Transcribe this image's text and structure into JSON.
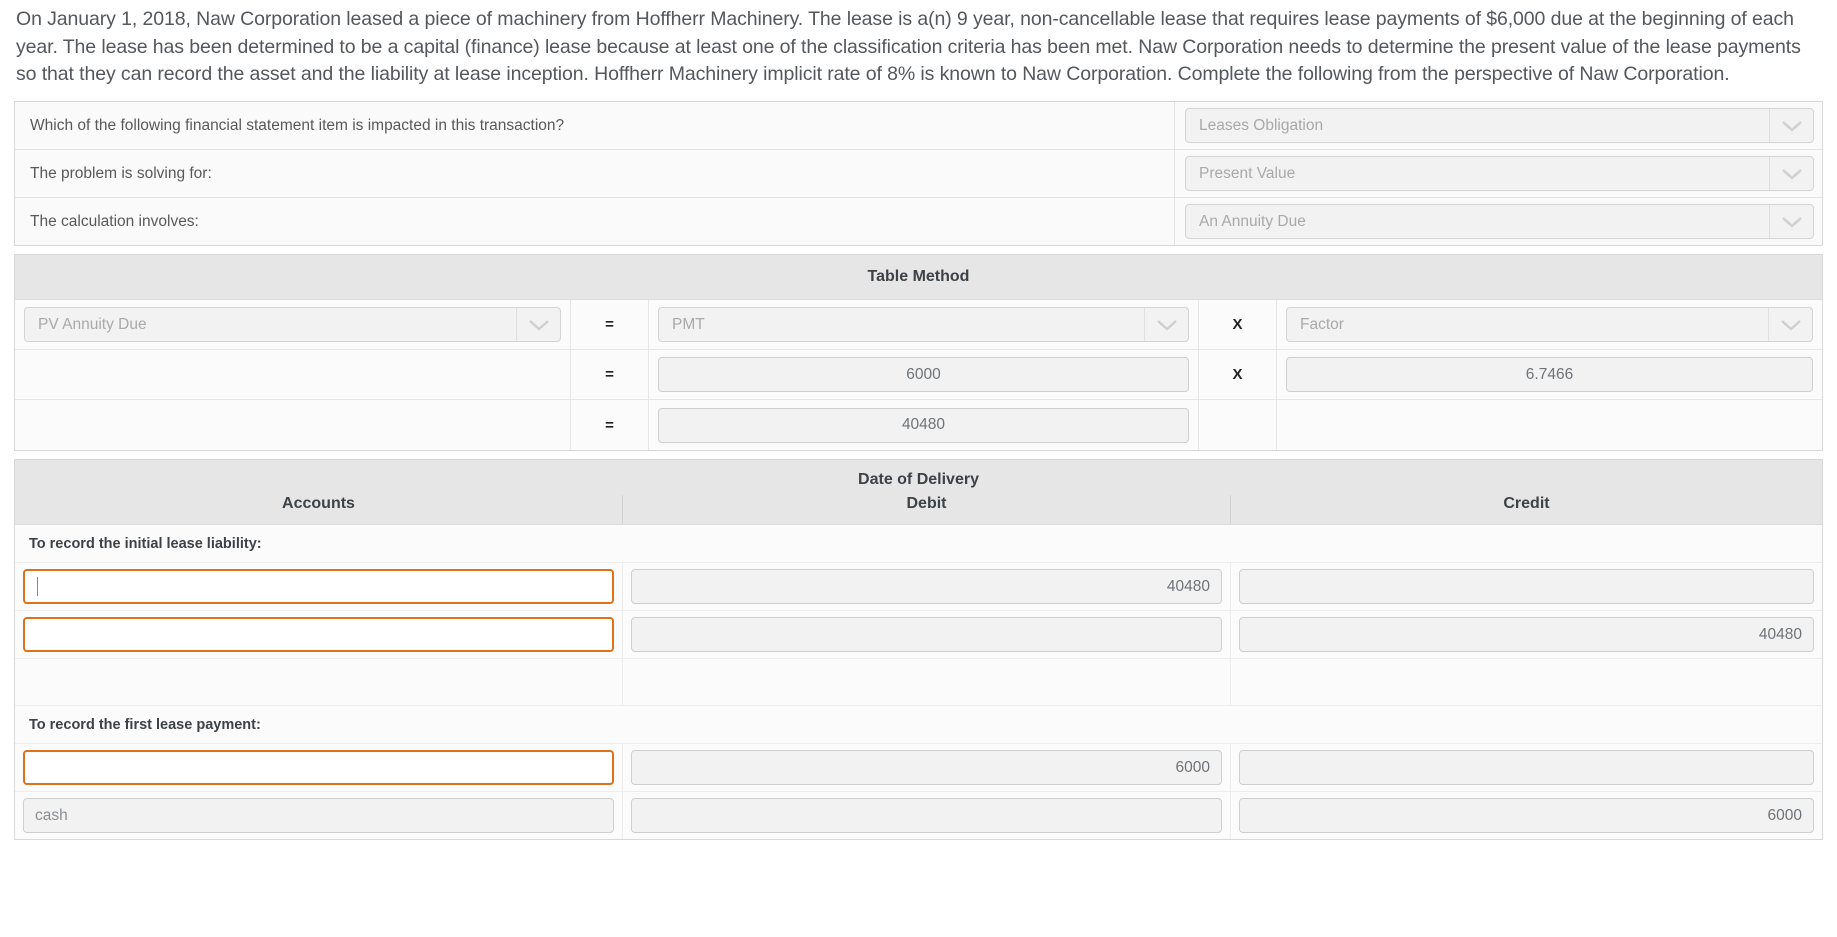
{
  "intro": {
    "paragraph": "On January 1, 2018, Naw Corporation leased a piece of machinery from Hoffherr Machinery. The lease is a(n) 9 year, non-cancellable lease that requires lease payments of $6,000 due at the beginning of each year. The lease has been determined to be a capital (finance) lease because at least one of the classification criteria has been met. Naw Corporation needs to determine the present value of the lease payments so that they can record the asset and the liability at lease inception. Hoffherr Machinery implicit rate of 8% is known to Naw Corporation. Complete the following from the perspective of Naw Corporation."
  },
  "questions": [
    {
      "label": "Which of the following financial statement item is impacted in this transaction?",
      "value": "Leases Obligation",
      "icon": "chevron-down-icon"
    },
    {
      "label": "The problem is solving for:",
      "value": "Present Value",
      "icon": "chevron-down-icon"
    },
    {
      "label": "The calculation involves:",
      "value": "An Annuity Due",
      "icon": "chevron-down-icon"
    }
  ],
  "table_method": {
    "title": "Table Method",
    "rows": [
      {
        "c1": "PV Annuity Due",
        "c1_type": "select",
        "op1": "=",
        "c2": "PMT",
        "c2_type": "select",
        "op2": "X",
        "c3": "Factor",
        "c3_type": "select"
      },
      {
        "c1": "",
        "c1_type": "blank",
        "op1": "=",
        "c2": "6000",
        "c2_type": "value",
        "op2": "X",
        "c3": "6.7466",
        "c3_type": "value"
      },
      {
        "c1": "",
        "c1_type": "blank",
        "op1": "=",
        "c2": "40480",
        "c2_type": "value",
        "op2": "",
        "c3": "",
        "c3_type": "blank"
      }
    ]
  },
  "journal": {
    "title": "Date of Delivery",
    "headers": {
      "accounts": "Accounts",
      "debit": "Debit",
      "credit": "Credit"
    },
    "groups": [
      {
        "caption": "To record the initial lease liability:",
        "rows": [
          {
            "account": "",
            "account_state": "focused",
            "debit": "40480",
            "credit": ""
          },
          {
            "account": "",
            "account_state": "active",
            "debit": "",
            "credit": "40480"
          },
          {
            "account": null,
            "account_state": "none",
            "debit": null,
            "credit": null
          }
        ]
      },
      {
        "caption": "To record the first lease payment:",
        "rows": [
          {
            "account": "",
            "account_state": "active",
            "debit": "6000",
            "credit": ""
          },
          {
            "account": "cash",
            "account_state": "filled",
            "debit": "",
            "credit": "6000"
          }
        ]
      }
    ]
  },
  "colors": {
    "accent": "#e0711b",
    "header_bg": "#e6e6e6",
    "field_bg": "#f2f2f2",
    "text": "#53585c"
  }
}
